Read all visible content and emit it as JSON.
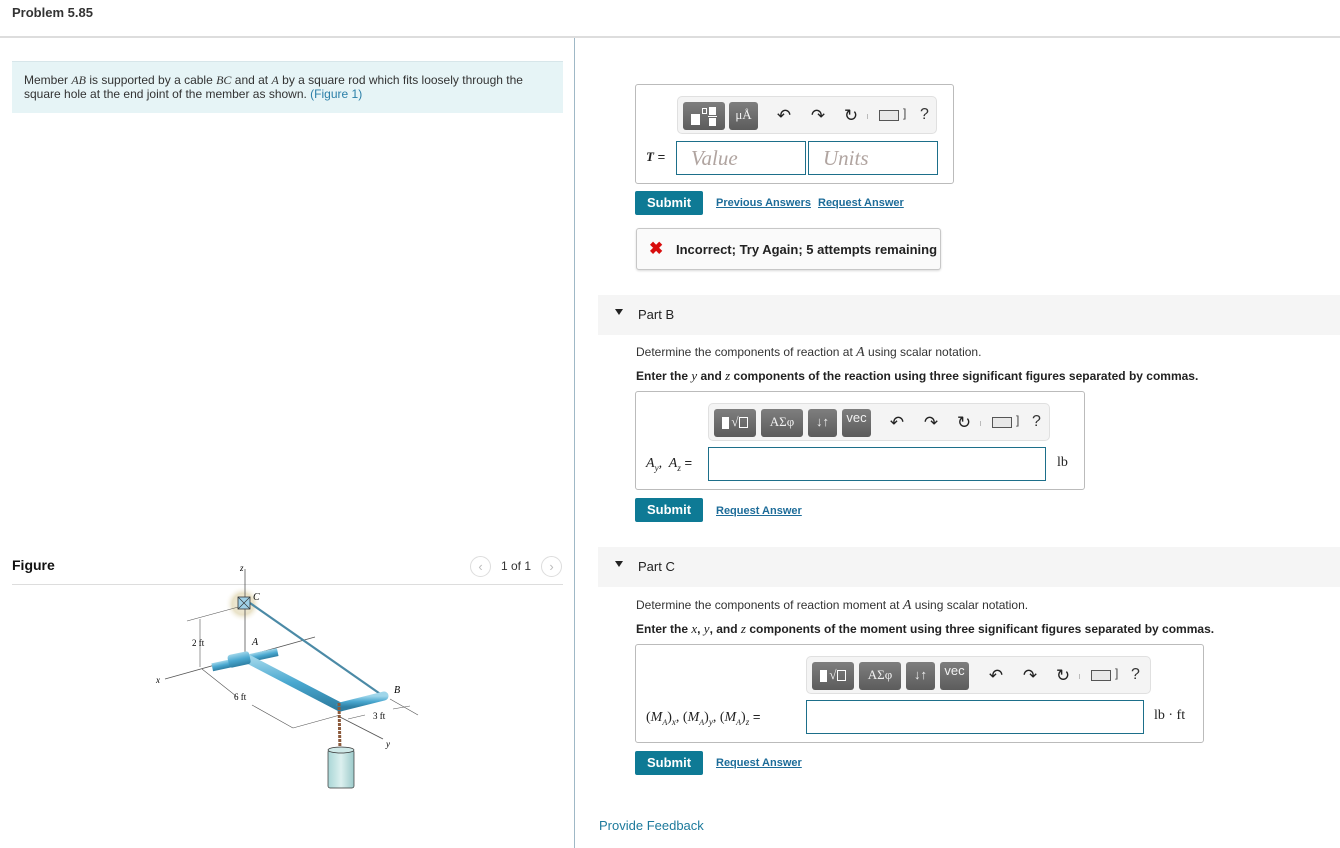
{
  "header": {
    "title": "Problem 5.85"
  },
  "intro": {
    "text_1": "Member ",
    "var_1": "AB",
    "text_2": " is supported by a cable ",
    "var_2": "BC",
    "text_3": " and at ",
    "var_3": "A",
    "text_4": " by a square rod which fits loosely through the square hole at the end joint of the member as shown. ",
    "figure_link": "(Figure 1)"
  },
  "figure": {
    "label": "Figure",
    "pager": {
      "prev_icon": "chevron-left-icon",
      "next_icon": "chevron-right-icon",
      "count": "1 of 1"
    },
    "image_labels": {
      "z": "z",
      "c": "C",
      "a": "A",
      "b": "B",
      "x": "x",
      "y": "y",
      "dim_2ft": "2 ft",
      "dim_6ft": "6 ft",
      "dim_3ft": "3 ft"
    }
  },
  "part_a": {
    "toolbar": {
      "btn_template": "template-icon",
      "btn_units": "μÅ",
      "undo": "↶",
      "redo": "↷",
      "reset": "↻",
      "help": "?"
    },
    "label": "T =",
    "value_placeholder": "Value",
    "units_placeholder": "Units",
    "submit": "Submit",
    "previous_answers": "Previous Answers",
    "request_answer": "Request Answer",
    "feedback": {
      "icon": "✖",
      "text": "Incorrect; Try Again; 5 attempts remaining"
    }
  },
  "part_b": {
    "title": "Part B",
    "prompt_1a": "Determine the components of reaction at ",
    "prompt_1var": "A",
    "prompt_1b": " using scalar notation.",
    "prompt_2a": "Enter the ",
    "prompt_2y": "y",
    "prompt_2b": " and ",
    "prompt_2z": "z",
    "prompt_2c": " components of the reaction using three significant figures separated by commas.",
    "toolbar": {
      "btn_sqrt": "√",
      "btn_greek": "ΑΣφ",
      "btn_arrows": "↓↑",
      "btn_vec": "vec",
      "undo": "↶",
      "redo": "↷",
      "reset": "↻",
      "help": "?"
    },
    "label": "A_y, A_z =",
    "value": "",
    "unit": "lb",
    "submit": "Submit",
    "request_answer": "Request Answer"
  },
  "part_c": {
    "title": "Part C",
    "prompt_1a": "Determine the components of reaction moment at ",
    "prompt_1var": "A",
    "prompt_1b": " using scalar notation.",
    "prompt_2a": "Enter the ",
    "prompt_2x": "x",
    "prompt_2sep1": ", ",
    "prompt_2y": "y",
    "prompt_2b": ", and ",
    "prompt_2z": "z",
    "prompt_2c": " components of the moment using three significant figures separated by commas.",
    "toolbar": {
      "btn_sqrt": "√",
      "btn_greek": "ΑΣφ",
      "btn_arrows": "↓↑",
      "btn_vec": "vec",
      "undo": "↶",
      "redo": "↷",
      "reset": "↻",
      "help": "?"
    },
    "label": "(M_A)_x, (M_A)_y, (M_A)_z =",
    "value": "",
    "unit": "lb · ft",
    "submit": "Submit",
    "request_answer": "Request Answer"
  },
  "footer": {
    "provide_feedback": "Provide Feedback"
  },
  "colors": {
    "accent": "#0e7a95",
    "link": "#1d6c99",
    "intro_bg": "#e6f4f6",
    "error": "#d80d0d",
    "input_border": "#1d6f8a"
  }
}
